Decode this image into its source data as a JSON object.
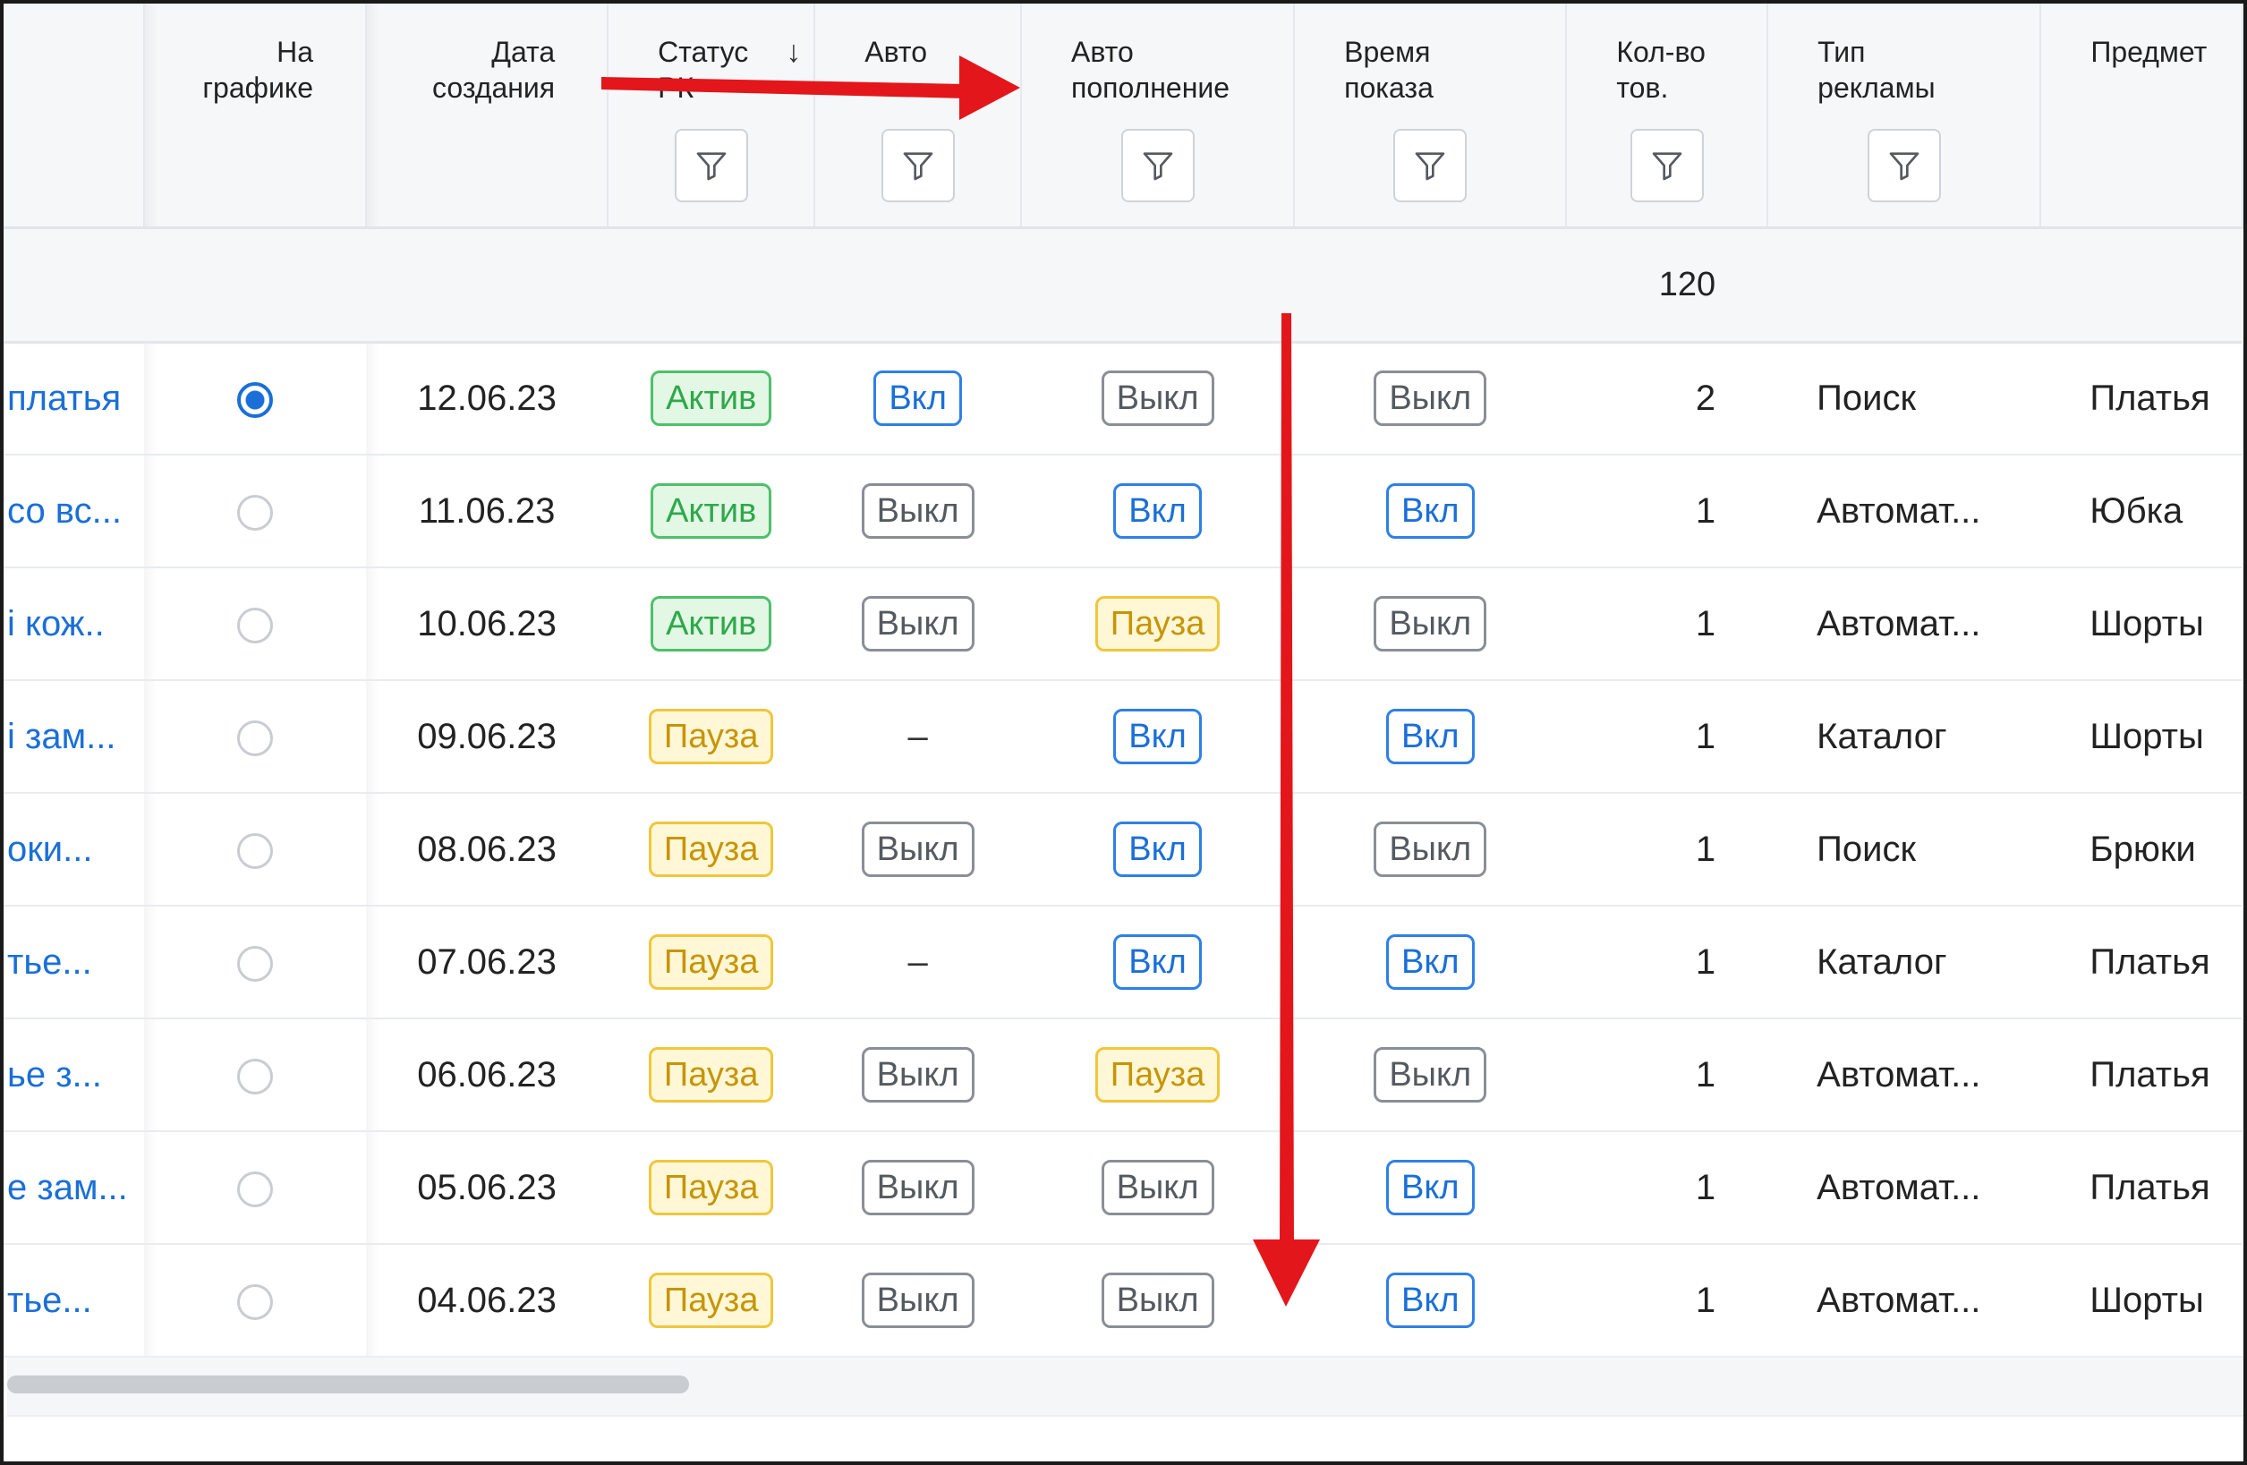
{
  "columns": [
    {
      "id": "name",
      "label1": "",
      "label2": ""
    },
    {
      "id": "on_chart",
      "label1": "На",
      "label2": "графике"
    },
    {
      "id": "created",
      "label1": "Дата",
      "label2": "создания"
    },
    {
      "id": "status",
      "label1": "Статус",
      "label2": "РК",
      "sort_icon": "arrow-down-icon",
      "sort_glyph": "↓"
    },
    {
      "id": "auto",
      "label1": "Авто",
      "label2": ""
    },
    {
      "id": "autorefill",
      "label1": "Авто",
      "label2": "пополнение"
    },
    {
      "id": "showtime",
      "label1": "Время",
      "label2": "показа"
    },
    {
      "id": "count",
      "label1": "Кол-во",
      "label2": "тов."
    },
    {
      "id": "adtype",
      "label1": "Тип",
      "label2": "рекламы"
    },
    {
      "id": "subject",
      "label1": "Предмет",
      "label2": ""
    }
  ],
  "summary": {
    "count_total": "120"
  },
  "rows": [
    {
      "name": "платья",
      "on_chart": true,
      "created": "12.06.23",
      "status": "Актив",
      "auto": "Вкл",
      "autorefill": "Выкл",
      "showtime": "Выкл",
      "count": "2",
      "adtype": "Поиск",
      "subject": "Платья"
    },
    {
      "name": "со вс...",
      "on_chart": false,
      "created": "11.06.23",
      "status": "Актив",
      "auto": "Выкл",
      "autorefill": "Вкл",
      "showtime": "Вкл",
      "count": "1",
      "adtype": "Автомат...",
      "subject": "Юбка"
    },
    {
      "name": "і кож..",
      "on_chart": false,
      "created": "10.06.23",
      "status": "Актив",
      "auto": "Выкл",
      "autorefill": "Пауза",
      "showtime": "Выкл",
      "count": "1",
      "adtype": "Автомат...",
      "subject": "Шорты"
    },
    {
      "name": "і зам...",
      "on_chart": false,
      "created": "09.06.23",
      "status": "Пауза",
      "auto": "–",
      "autorefill": "Вкл",
      "showtime": "Вкл",
      "count": "1",
      "adtype": "Каталог",
      "subject": "Шорты"
    },
    {
      "name": "оки...",
      "on_chart": false,
      "created": "08.06.23",
      "status": "Пауза",
      "auto": "Выкл",
      "autorefill": "Вкл",
      "showtime": "Выкл",
      "count": "1",
      "adtype": "Поиск",
      "subject": "Брюки"
    },
    {
      "name": "тье...",
      "on_chart": false,
      "created": "07.06.23",
      "status": "Пауза",
      "auto": "–",
      "autorefill": "Вкл",
      "showtime": "Вкл",
      "count": "1",
      "adtype": "Каталог",
      "subject": "Платья"
    },
    {
      "name": "ье з...",
      "on_chart": false,
      "created": "06.06.23",
      "status": "Пауза",
      "auto": "Выкл",
      "autorefill": "Пауза",
      "showtime": "Выкл",
      "count": "1",
      "adtype": "Автомат...",
      "subject": "Платья"
    },
    {
      "name": "е зам...",
      "on_chart": false,
      "created": "05.06.23",
      "status": "Пауза",
      "auto": "Выкл",
      "autorefill": "Выкл",
      "showtime": "Вкл",
      "count": "1",
      "adtype": "Автомат...",
      "subject": "Платья"
    },
    {
      "name": "тье...",
      "on_chart": false,
      "created": "04.06.23",
      "status": "Пауза",
      "auto": "Выкл",
      "autorefill": "Выкл",
      "showtime": "Вкл",
      "count": "1",
      "adtype": "Автомат...",
      "subject": "Шорты"
    }
  ],
  "tag_colors": {
    "Актив": "green",
    "Пауза": "yellow",
    "Вкл": "blue",
    "Выкл": "gray"
  },
  "icons": {
    "filter": "filter-funnel-icon",
    "radio": "radio-button-icon",
    "annotation_arrow": "red-arrow"
  },
  "colors": {
    "accent": "#1a6fd8",
    "active": "#2ea84a",
    "pause": "#f0c63b",
    "annotation": "#e3161b"
  }
}
